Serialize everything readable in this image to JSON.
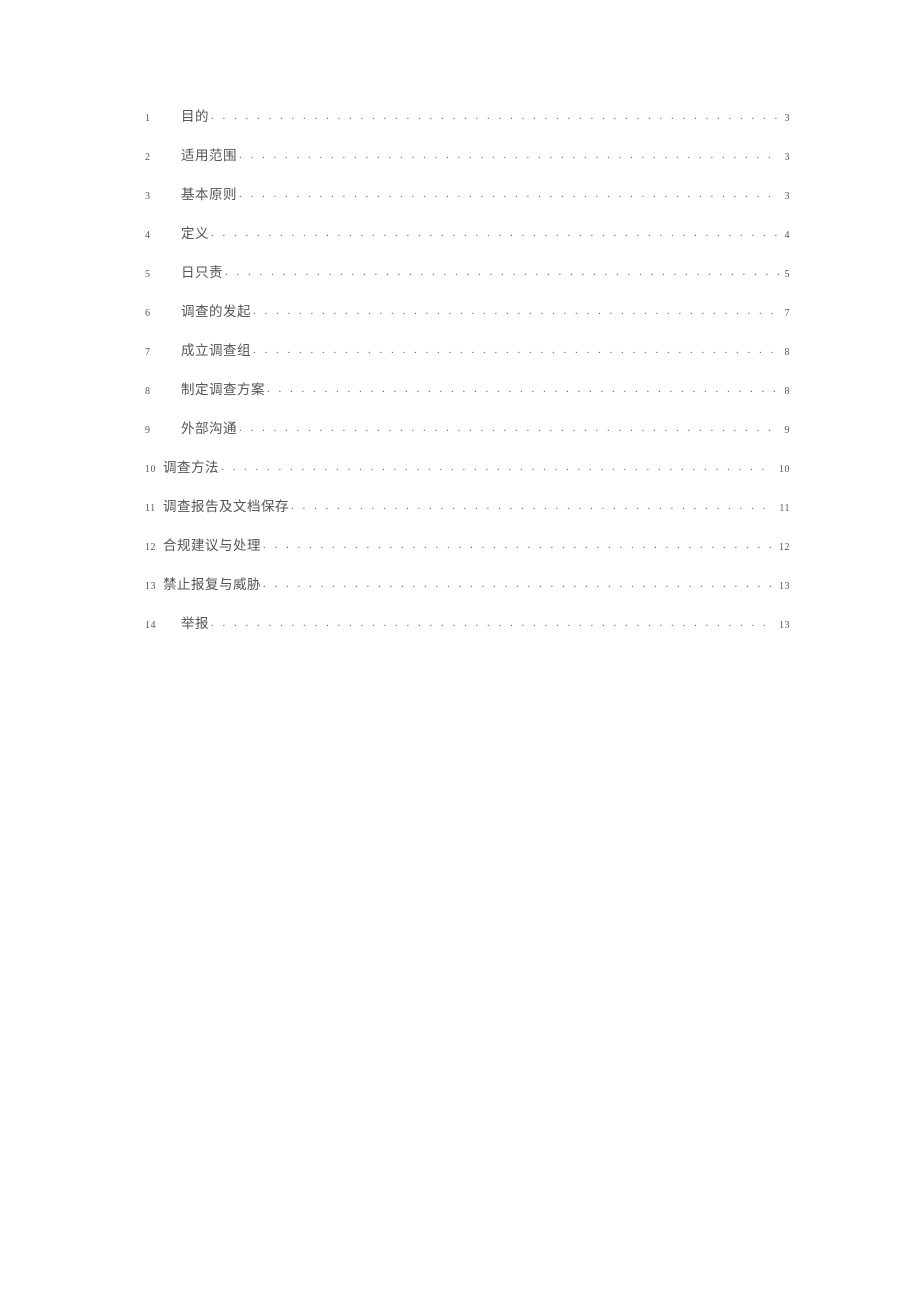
{
  "toc": {
    "entries": [
      {
        "num": "1",
        "title": "目的",
        "page": "3",
        "indent": true
      },
      {
        "num": "2",
        "title": "适用范围",
        "page": "3",
        "indent": true
      },
      {
        "num": "3",
        "title": "基本原则",
        "page": "3",
        "indent": true
      },
      {
        "num": "4",
        "title": "定义",
        "page": "4",
        "indent": true
      },
      {
        "num": "5",
        "title": "日只责",
        "page": "5",
        "indent": true
      },
      {
        "num": "6",
        "title": "调查的发起",
        "page": "7",
        "indent": true
      },
      {
        "num": "7",
        "title": "成立调查组",
        "page": "8",
        "indent": true
      },
      {
        "num": "8",
        "title": "制定调查方案",
        "page": "8",
        "indent": true
      },
      {
        "num": "9",
        "title": "外部沟通",
        "page": "9",
        "indent": true
      },
      {
        "num": "10",
        "title": "调查方法",
        "page": "10",
        "indent": false
      },
      {
        "num": "11",
        "title": "调查报告及文档保存",
        "page": "11",
        "indent": false
      },
      {
        "num": "12",
        "title": "合规建议与处理",
        "page": "12",
        "indent": false
      },
      {
        "num": "13",
        "title": "禁止报复与威胁",
        "page": "13",
        "indent": false
      },
      {
        "num": "14",
        "title": "举报",
        "page": "13",
        "indent": true
      }
    ]
  }
}
